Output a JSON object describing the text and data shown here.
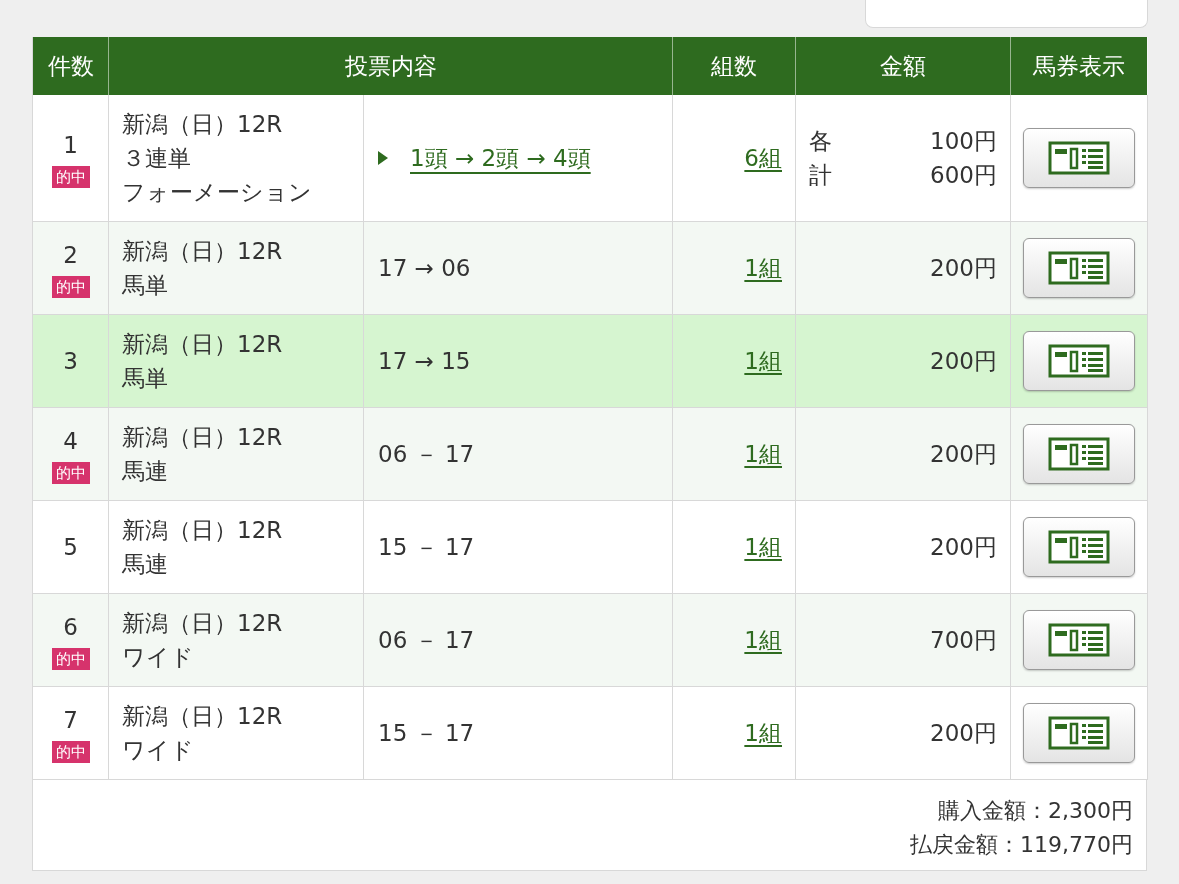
{
  "columns": [
    "件数",
    "投票内容",
    "組数",
    "金額",
    "馬券表示"
  ],
  "rows": [
    {
      "no": "1",
      "hit_label": "的中",
      "highlighted": false,
      "race": "新潟（日）12R",
      "bet_type": [
        "３連単",
        "フォーメーション"
      ],
      "content": {
        "kind": "link",
        "text": "1頭 → 2頭 → 4頭"
      },
      "combos": "6組",
      "amounts": [
        {
          "label": "各",
          "value": "100円"
        },
        {
          "label": "計",
          "value": "600円"
        }
      ]
    },
    {
      "no": "2",
      "hit_label": "的中",
      "highlighted": false,
      "race": "新潟（日）12R",
      "bet_type": [
        "馬単"
      ],
      "content": {
        "kind": "text",
        "text": "17 → 06"
      },
      "combos": "1組",
      "amounts": [
        {
          "value": "200円"
        }
      ]
    },
    {
      "no": "3",
      "highlighted": true,
      "race": "新潟（日）12R",
      "bet_type": [
        "馬単"
      ],
      "content": {
        "kind": "text",
        "text": "17 → 15"
      },
      "combos": "1組",
      "amounts": [
        {
          "value": "200円"
        }
      ]
    },
    {
      "no": "4",
      "hit_label": "的中",
      "highlighted": false,
      "race": "新潟（日）12R",
      "bet_type": [
        "馬連"
      ],
      "content": {
        "kind": "text",
        "text": "06 － 17"
      },
      "combos": "1組",
      "amounts": [
        {
          "value": "200円"
        }
      ]
    },
    {
      "no": "5",
      "highlighted": false,
      "race": "新潟（日）12R",
      "bet_type": [
        "馬連"
      ],
      "content": {
        "kind": "text",
        "text": "15 － 17"
      },
      "combos": "1組",
      "amounts": [
        {
          "value": "200円"
        }
      ]
    },
    {
      "no": "6",
      "hit_label": "的中",
      "highlighted": false,
      "race": "新潟（日）12R",
      "bet_type": [
        "ワイド"
      ],
      "content": {
        "kind": "text",
        "text": "06 － 17"
      },
      "combos": "1組",
      "amounts": [
        {
          "value": "700円"
        }
      ]
    },
    {
      "no": "7",
      "hit_label": "的中",
      "highlighted": false,
      "race": "新潟（日）12R",
      "bet_type": [
        "ワイド"
      ],
      "content": {
        "kind": "text",
        "text": "15 － 17"
      },
      "combos": "1組",
      "amounts": [
        {
          "value": "200円"
        }
      ]
    }
  ],
  "totals": [
    "購入金額：2,300円",
    "払戻金額：119,770円"
  ]
}
